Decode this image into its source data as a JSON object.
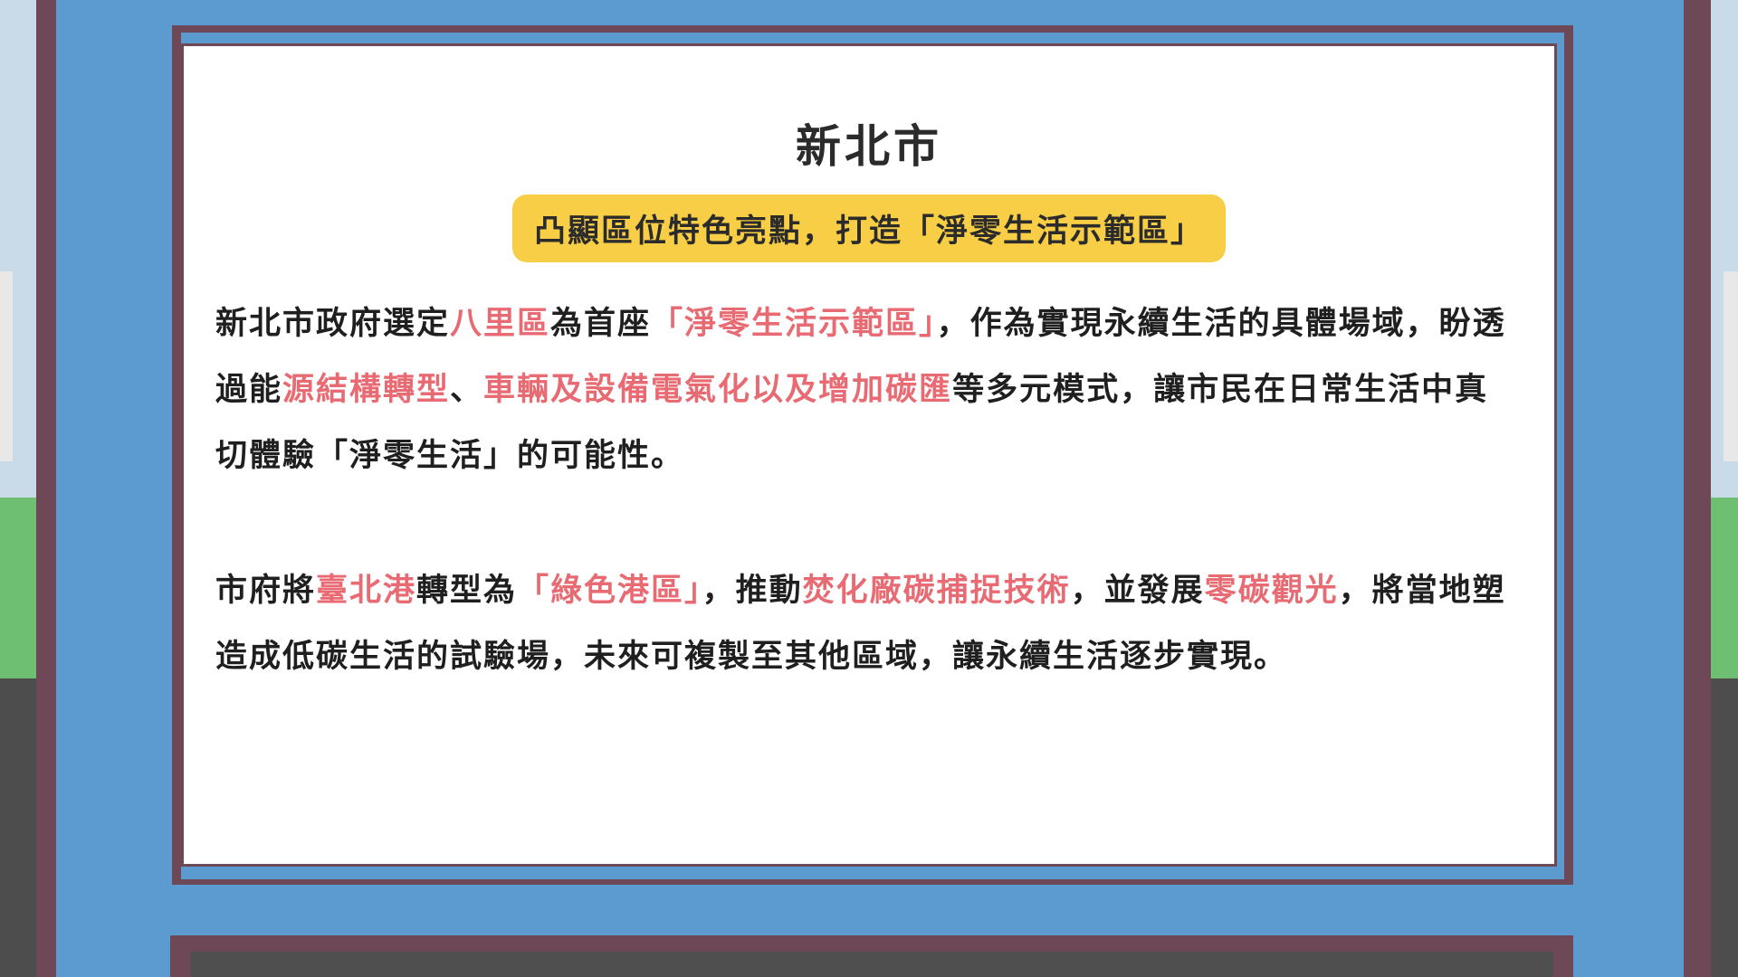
{
  "title": "新北市",
  "subtitle": "凸顯區位特色亮點，打造「淨零生活示範區」",
  "paragraph1": {
    "s1": "新北市政府選定",
    "h1": "八里區",
    "s2": "為首座",
    "h2": "「淨零生活示範區」",
    "s3": "，作為實現永續生活的具體場域，盼透過能",
    "h3": "源結構轉型",
    "s4": "、",
    "h4": "車輛及設備電氣化以及增加碳匯",
    "s5": "等多元模式，讓市民在日常生活中真切體驗「淨零生活」的可能性。"
  },
  "paragraph2": {
    "s1": "市府將",
    "h1": "臺北港",
    "s2": "轉型為",
    "h2": "「綠色港區」",
    "s3": "，推動",
    "h3": "焚化廠碳捕捉技術",
    "s4": "，並發展",
    "h4": "零碳觀光",
    "s5": "，將當地塑造成低碳生活的試驗場，未來可複製至其他區域，讓永續生活逐步實現。"
  },
  "colors": {
    "highlight": "#e86a72",
    "badge": "#f7ce46",
    "frame": "#6e4857",
    "background": "#5b9bd0"
  }
}
